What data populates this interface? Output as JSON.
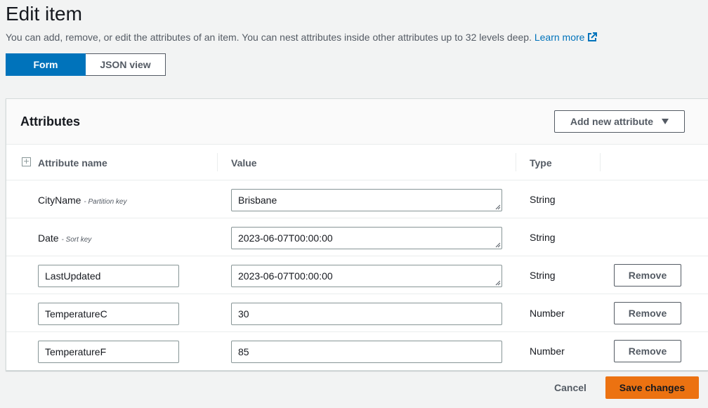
{
  "page": {
    "title": "Edit item",
    "description": "You can add, remove, or edit the attributes of an item. You can nest attributes inside other attributes up to 32 levels deep.",
    "learn_more": "Learn more"
  },
  "view_toggle": {
    "form": "Form",
    "json": "JSON view",
    "selected": "Form"
  },
  "attributes": {
    "title": "Attributes",
    "add_button": "Add new attribute",
    "columns": {
      "name": "Attribute name",
      "value": "Value",
      "type": "Type"
    },
    "rows": [
      {
        "name": "CityName",
        "key_note": "- Partition key",
        "value": "Brisbane",
        "type": "String"
      },
      {
        "name": "Date",
        "key_note": "- Sort key",
        "value": "2023-06-07T00:00:00",
        "type": "String"
      },
      {
        "name": "LastUpdated",
        "value": "2023-06-07T00:00:00",
        "type": "String",
        "remove": "Remove"
      },
      {
        "name": "TemperatureC",
        "value": "30",
        "type": "Number",
        "remove": "Remove"
      },
      {
        "name": "TemperatureF",
        "value": "85",
        "type": "Number",
        "remove": "Remove"
      }
    ]
  },
  "footer": {
    "cancel": "Cancel",
    "save": "Save changes"
  },
  "colors": {
    "primary": "#0073bb",
    "save": "#ec7211",
    "link": "#0073bb"
  }
}
